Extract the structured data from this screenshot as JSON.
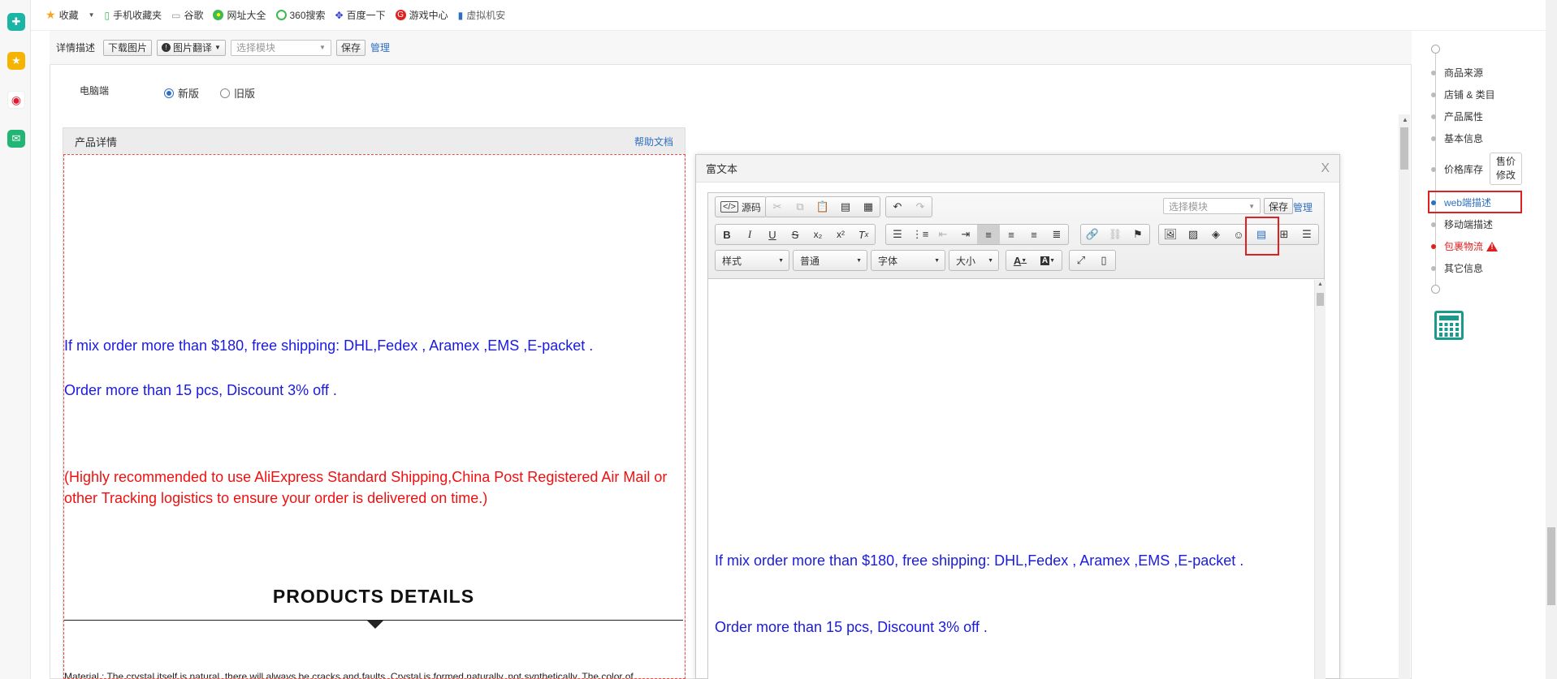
{
  "bookmarks": [
    {
      "icon": "star-icon",
      "label": "收藏",
      "color": "#f5a623"
    },
    {
      "icon": "phone-icon",
      "label": "手机收藏夹",
      "color": "#3cba54"
    },
    {
      "icon": "page-icon",
      "label": "谷歌",
      "color": "#999999"
    },
    {
      "icon": "navigation-icon",
      "label": "网址大全",
      "color": "#3cba54"
    },
    {
      "icon": "360-icon",
      "label": "360搜索",
      "color": "#3cba54"
    },
    {
      "icon": "baidu-icon",
      "label": "百度一下",
      "color": "#2932e1"
    },
    {
      "icon": "game-icon",
      "label": "游戏中心",
      "color": "#e02020"
    },
    {
      "icon": "doc-icon",
      "label": "虚拟机安",
      "color": "#2e6fc4"
    }
  ],
  "topbar": {
    "title": "详情描述",
    "download_images": "下载图片",
    "translate_images": "图片翻译",
    "module_placeholder": "选择模块",
    "save": "保存",
    "manage": "管理"
  },
  "platform": {
    "label": "电脑端",
    "options": [
      {
        "label": "新版",
        "checked": true
      },
      {
        "label": "旧版",
        "checked": false
      }
    ]
  },
  "preview": {
    "title": "产品详情",
    "help": "帮助文档",
    "line1": "If mix order more than $180, free shipping: DHL,Fedex , Aramex ,EMS ,E-packet .",
    "line2": "Order more than 15 pcs, Discount 3% off .",
    "line3": "(Highly recommended to use AliExpress Standard Shipping,China Post Registered Air Mail or other Tracking logistics to ensure your order is delivered on time.)",
    "heading": "PRODUCTS DETAILS",
    "material": "Material : The crystal itself is natural, there will always be cracks and faults. Crystal is formed naturally, not synthetically. The color of"
  },
  "dialog": {
    "title": "富文本",
    "close": "X",
    "source": "源码",
    "module_placeholder": "选择模块",
    "save": "保存",
    "manage": "管理",
    "combo_style": "样式",
    "combo_format": "普通",
    "combo_font": "字体",
    "combo_size": "大小",
    "body_line1": "If mix order more than $180, free shipping: DHL,Fedex , Aramex ,EMS ,E-packet .",
    "body_line2": "Order more than 15 pcs, Discount 3% off ."
  },
  "nav": {
    "items": [
      {
        "label": "商品来源"
      },
      {
        "label": "店铺 & 类目"
      },
      {
        "label": "产品属性"
      },
      {
        "label": "基本信息"
      },
      {
        "label": "价格库存"
      },
      {
        "label": "web端描述"
      },
      {
        "label": "移动端描述"
      },
      {
        "label": "包裹物流"
      },
      {
        "label": "其它信息"
      }
    ],
    "price_edit_line1": "售价",
    "price_edit_line2": "修改",
    "warning_glyph": "!"
  },
  "colors": {
    "accent": "#2e6fc4",
    "highlight": "#e02020",
    "blue_text": "#1a1ae0",
    "red_text": "#f01010",
    "calculator": "#1a9a8a"
  }
}
